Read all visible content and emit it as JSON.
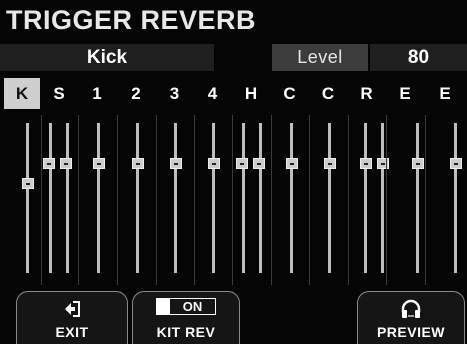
{
  "screen": {
    "title": "TRIGGER REVERB"
  },
  "kit_bar": {
    "kit_name": "Kick",
    "param_label": "Level",
    "param_value": "80"
  },
  "pads": [
    {
      "label": "K",
      "selected": true,
      "level": 0.6
    },
    {
      "label": "S",
      "selected": false,
      "level": 0.73
    },
    {
      "label": "1",
      "selected": false,
      "level": 0.73
    },
    {
      "label": "2",
      "selected": false,
      "level": 0.73
    },
    {
      "label": "3",
      "selected": false,
      "level": 0.73
    },
    {
      "label": "4",
      "selected": false,
      "level": 0.73
    },
    {
      "label": "H",
      "selected": false,
      "level": 0.73
    },
    {
      "label": "C",
      "selected": false,
      "level": 0.73
    },
    {
      "label": "C",
      "selected": false,
      "level": 0.73
    },
    {
      "label": "R",
      "selected": false,
      "level": 0.73
    },
    {
      "label": "E",
      "selected": false,
      "level": 0.73
    },
    {
      "label": "E",
      "selected": false,
      "level": 0.73
    }
  ],
  "buttons": {
    "exit": {
      "label": "EXIT",
      "icon": "exit-arrow-icon"
    },
    "kit_rev": {
      "label": "KIT REV",
      "toggle_state": "ON"
    },
    "preview": {
      "label": "PREVIEW",
      "icon": "headphones-icon"
    }
  }
}
